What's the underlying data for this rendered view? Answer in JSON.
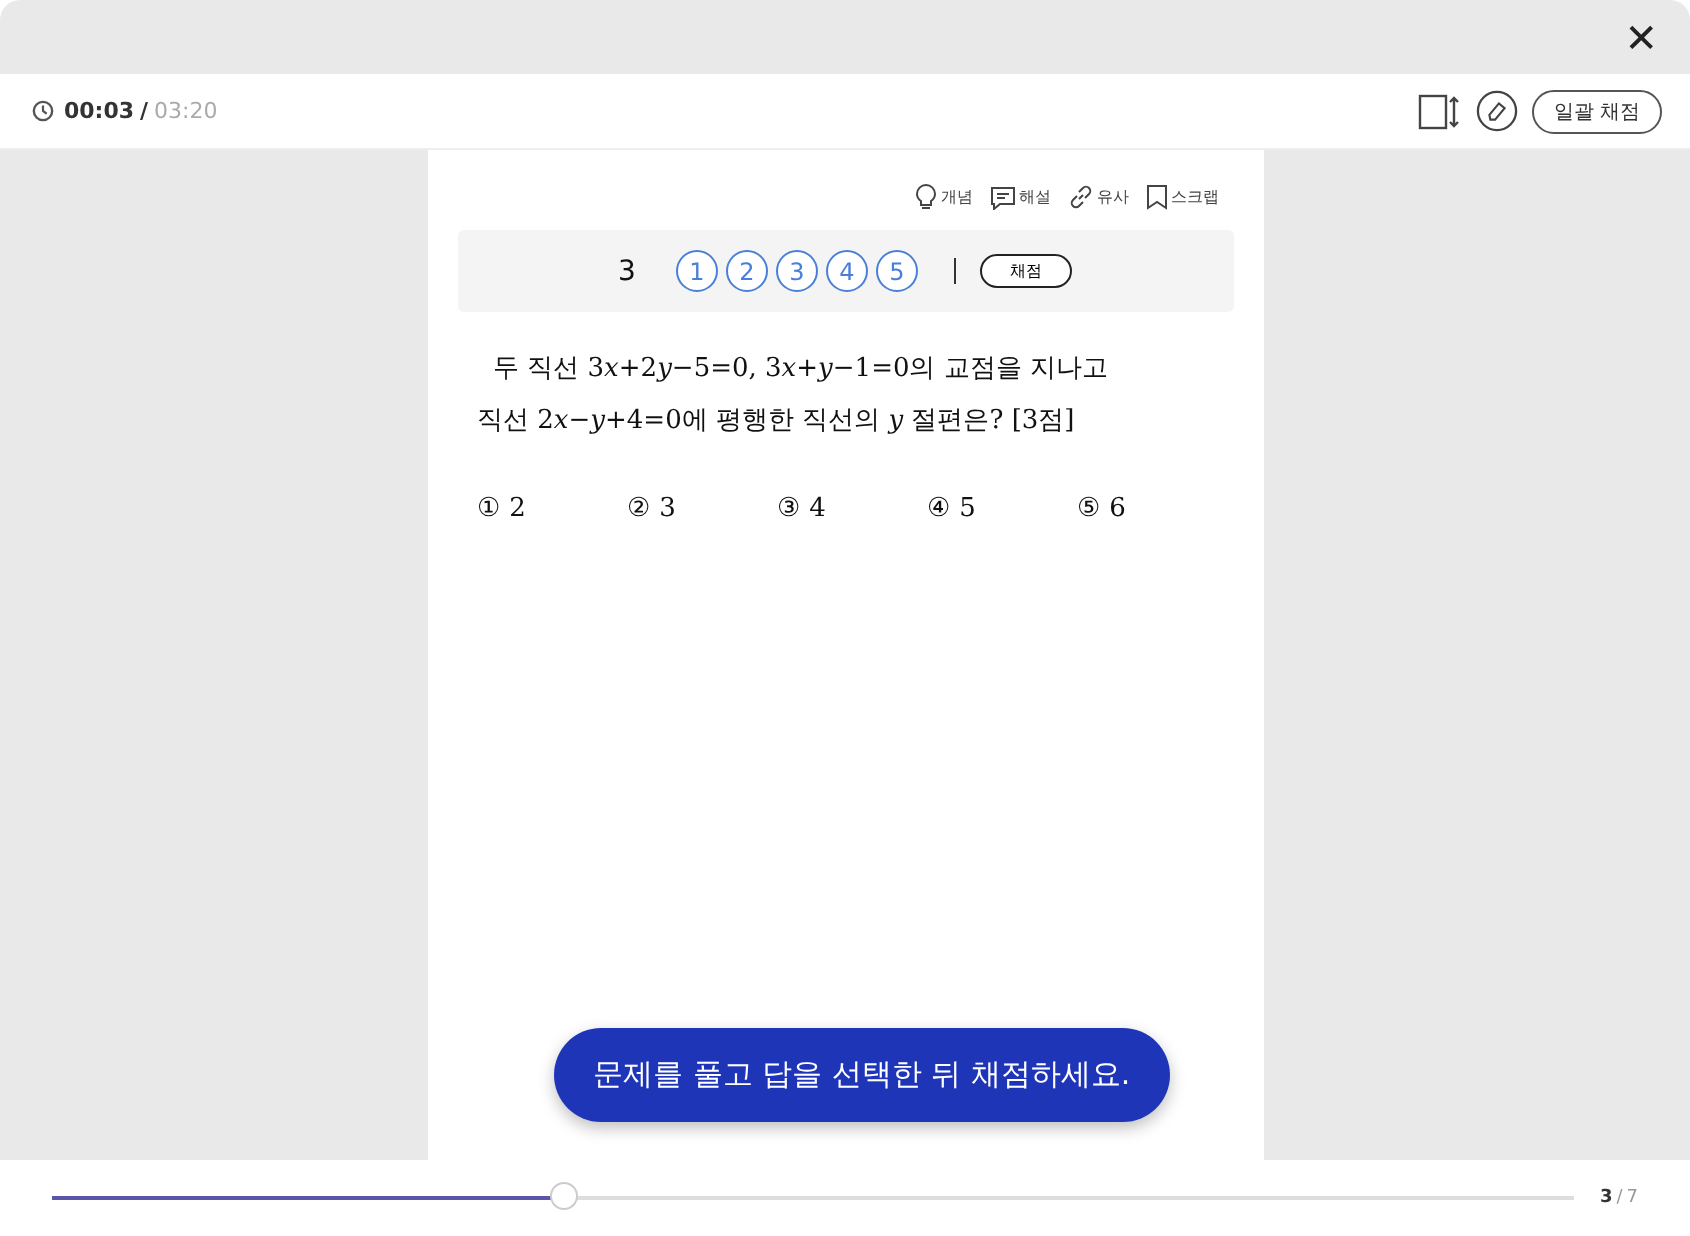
{
  "close_button": "✕",
  "timer": {
    "elapsed": "00:03",
    "separator": "/",
    "total": "03:20"
  },
  "toolbar": {
    "grade_all_button": "일괄 채점"
  },
  "tools": [
    {
      "label": "개념",
      "kind": "bulb"
    },
    {
      "label": "해설",
      "kind": "comment"
    },
    {
      "label": "유사",
      "kind": "link"
    },
    {
      "label": "스크랩",
      "kind": "bookmark"
    }
  ],
  "answer_bar": {
    "number": "3",
    "choices": [
      {
        "label": "1",
        "selected": false
      },
      {
        "label": "2",
        "selected": false
      },
      {
        "label": "3",
        "selected": false
      },
      {
        "label": "4",
        "selected": false
      },
      {
        "label": "5",
        "selected": false
      }
    ],
    "grade_button": "채점"
  },
  "question": {
    "lines": [
      [
        {
          "kind": "text",
          "t": "두 직선 3"
        },
        {
          "kind": "var",
          "t": "x"
        },
        {
          "kind": "text",
          "t": "+2"
        },
        {
          "kind": "var",
          "t": "y"
        },
        {
          "kind": "text",
          "t": "−5=0, 3"
        },
        {
          "kind": "var",
          "t": "x"
        },
        {
          "kind": "text",
          "t": "+"
        },
        {
          "kind": "var",
          "t": "y"
        },
        {
          "kind": "text",
          "t": "−1=0의 교점을 지나고"
        }
      ],
      [
        {
          "kind": "text",
          "t": "직선 2"
        },
        {
          "kind": "var",
          "t": "x"
        },
        {
          "kind": "text",
          "t": "−"
        },
        {
          "kind": "var",
          "t": "y"
        },
        {
          "kind": "text",
          "t": "+4=0에 평행한 직선의 "
        },
        {
          "kind": "var",
          "t": "y"
        },
        {
          "kind": "text",
          "t": " 절편은? [3점]"
        }
      ]
    ],
    "options": [
      "① 2",
      "② 3",
      "③ 4",
      "④ 5",
      "⑤ 6"
    ]
  },
  "toast": "문제를 풀고 답을 선택한 뒤 채점하세요.",
  "progress": {
    "level": 0.337,
    "current": "3",
    "separator": "/",
    "total": "7"
  }
}
